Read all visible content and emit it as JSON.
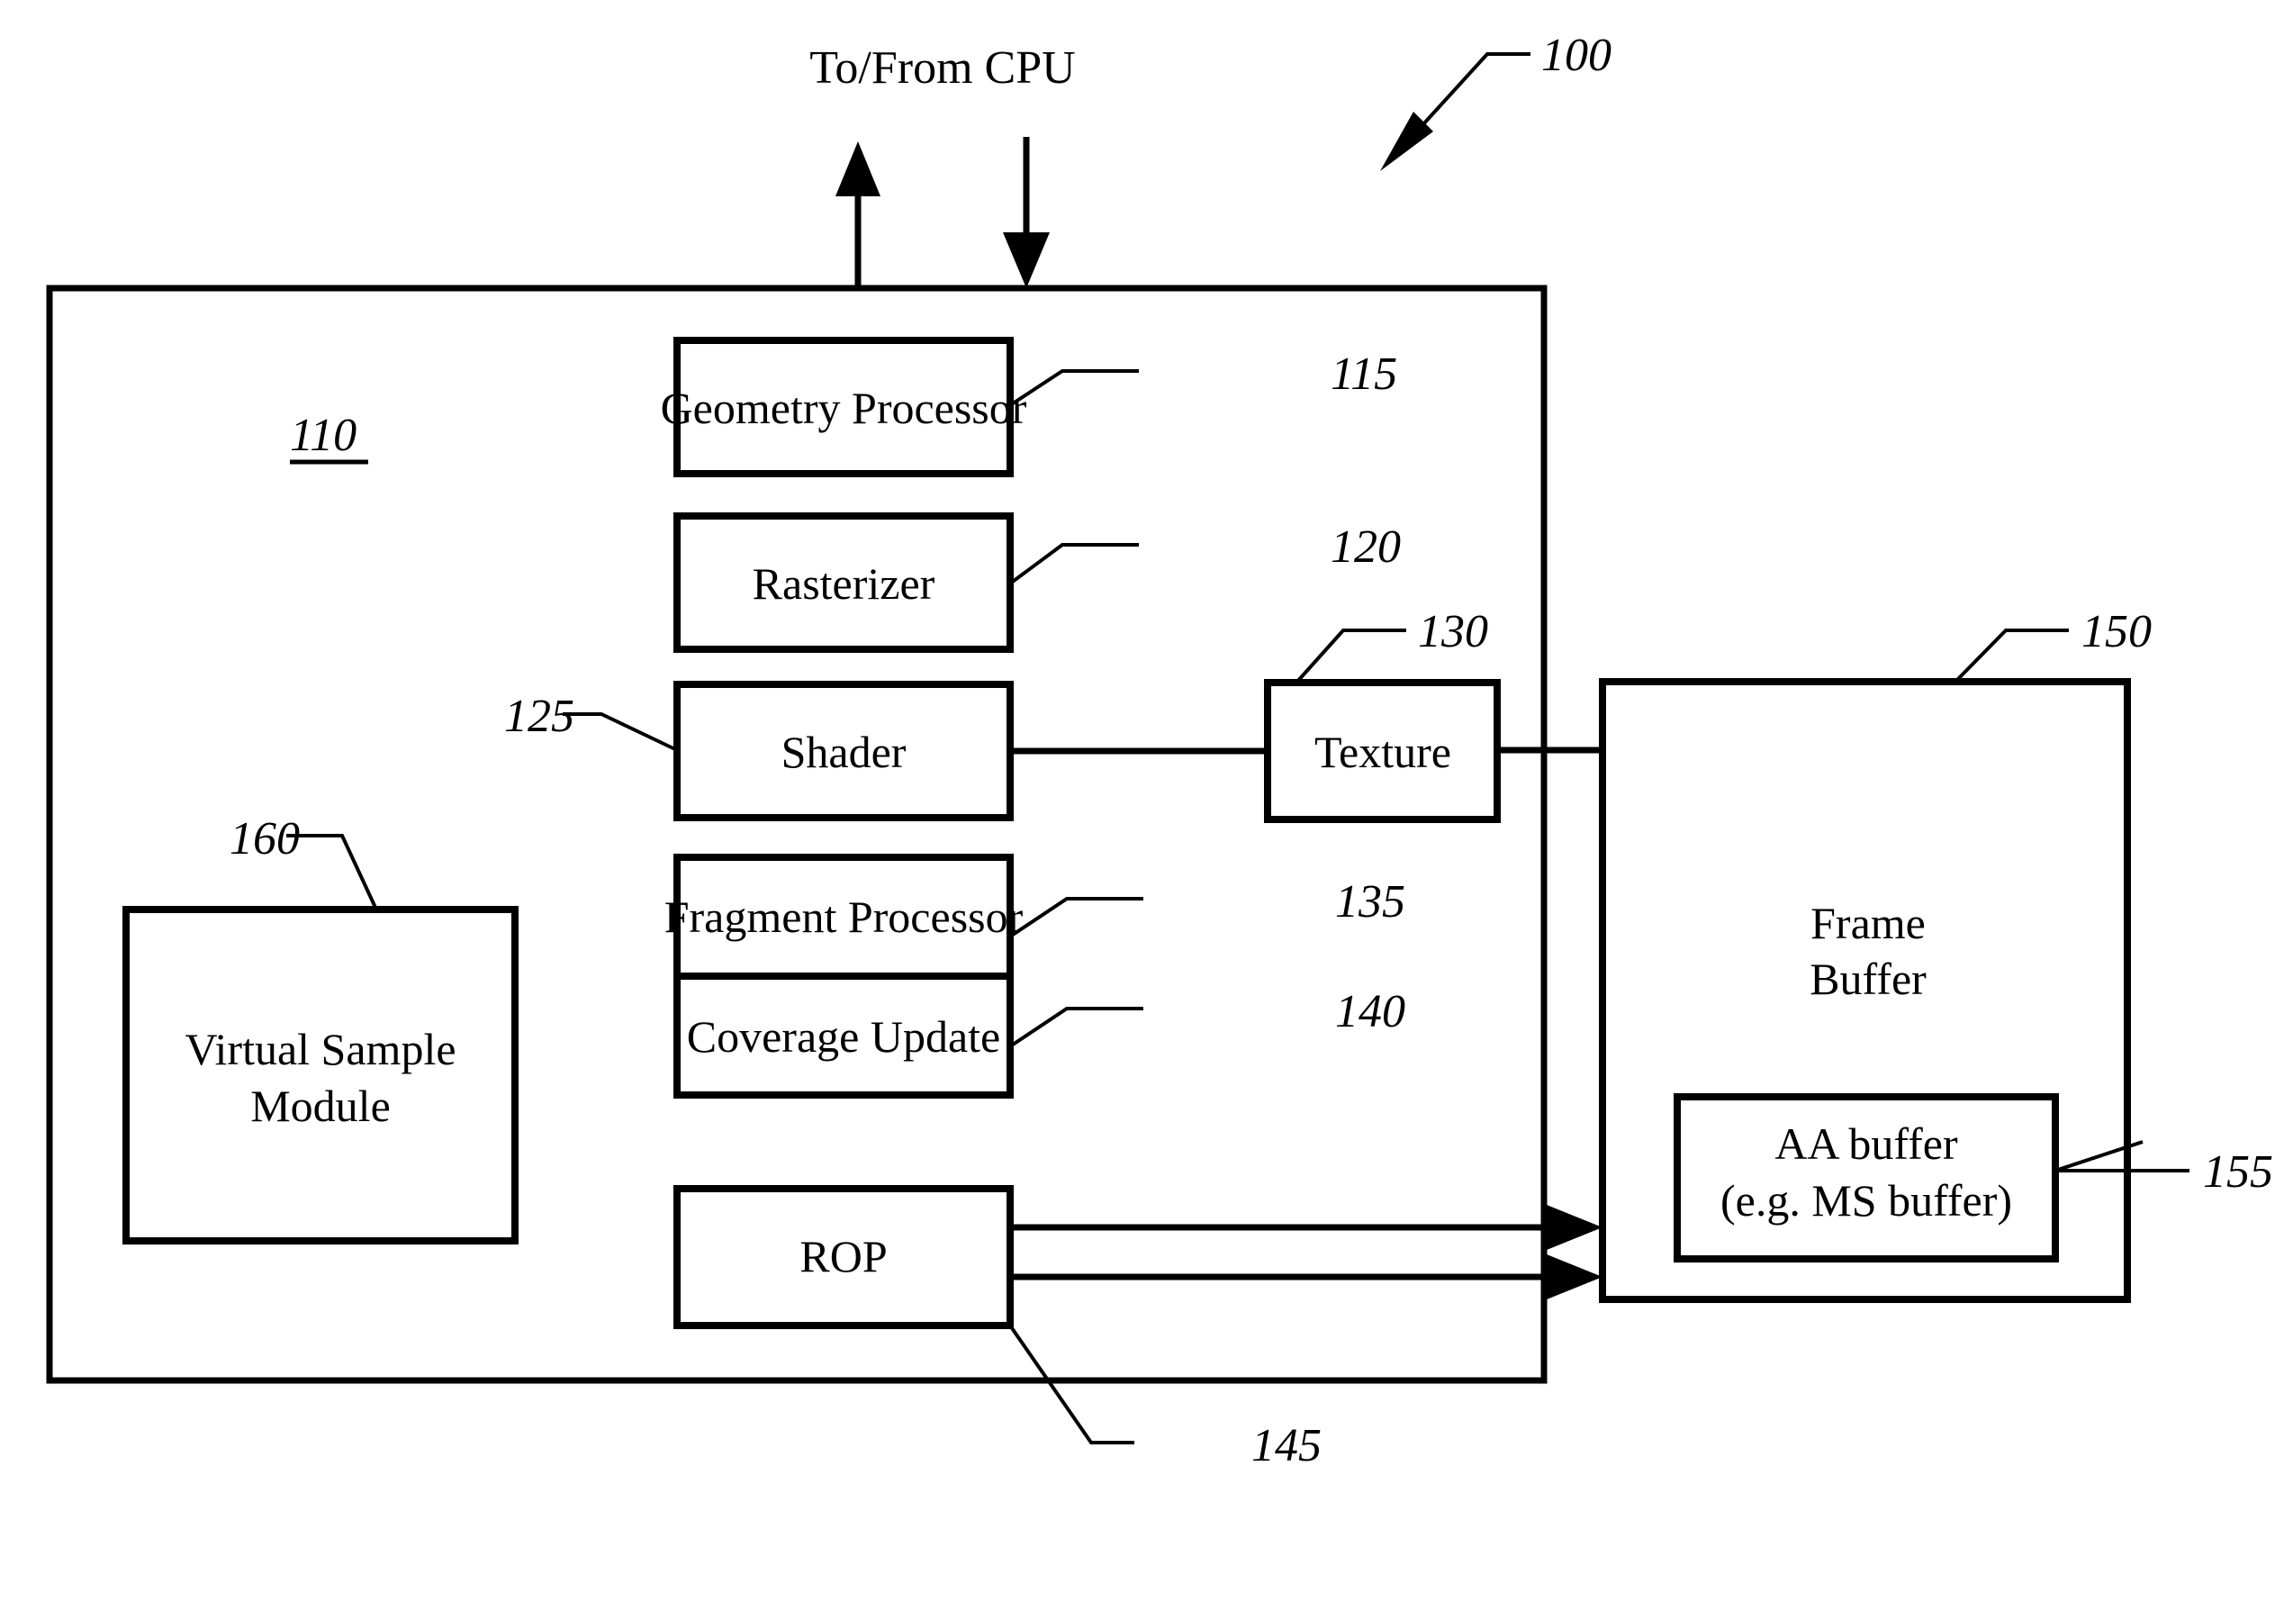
{
  "figure": {
    "title": "Graphics processing pipeline block diagram",
    "ink_color": "#000000",
    "background_color": "#ffffff"
  },
  "external_label": {
    "cpu_link": "To/From CPU"
  },
  "reference_numerals": {
    "system": "100",
    "gpu": "110",
    "geometry_processor": "115",
    "rasterizer": "120",
    "shader": "125",
    "texture": "130",
    "fragment_processor": "135",
    "coverage_update": "140",
    "rop": "145",
    "frame_buffer": "150",
    "aa_buffer": "155",
    "virtual_sample_module": "160"
  },
  "blocks": {
    "geometry_processor": {
      "label": "Geometry Processor"
    },
    "rasterizer": {
      "label": "Rasterizer"
    },
    "shader": {
      "label": "Shader"
    },
    "texture": {
      "label": "Texture"
    },
    "fragment_processor": {
      "label": "Fragment Processor"
    },
    "coverage_update": {
      "label": "Coverage Update"
    },
    "rop": {
      "label": "ROP"
    },
    "virtual_sample_module": {
      "line1": "Virtual Sample",
      "line2": "Module"
    },
    "frame_buffer": {
      "line1": "Frame",
      "line2": "Buffer"
    },
    "aa_buffer": {
      "line1": "AA buffer",
      "line2": "(e.g. MS buffer)"
    }
  }
}
